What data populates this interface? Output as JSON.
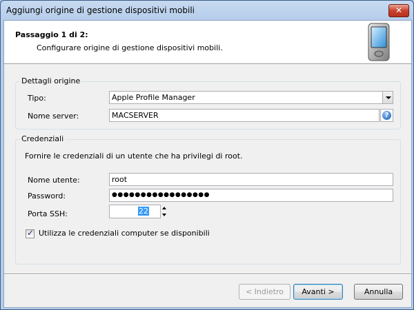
{
  "window": {
    "title": "Aggiungi origine di gestione dispositivi mobili",
    "close_symbol": "✕"
  },
  "header": {
    "step_title": "Passaggio 1 di 2:",
    "step_description": "Configurare origine di gestione dispositivi mobili.",
    "icon": "pda-device-icon"
  },
  "source_details": {
    "legend": "Dettagli origine",
    "type_label": "Tipo:",
    "type_value": "Apple Profile Manager",
    "server_label": "Nome server:",
    "server_value": "MACSERVER",
    "help_symbol": "?"
  },
  "credentials": {
    "legend": "Credenziali",
    "description": "Fornire le credenziali di un utente che ha privilegi di root.",
    "username_label": "Nome utente:",
    "username_value": "root",
    "password_label": "Password:",
    "password_value": "●●●●●●●●●●●●●●●●●",
    "ssh_port_label": "Porta SSH:",
    "ssh_port_value": "22",
    "use_computer_credentials_label": "Utilizza le credenziali computer se disponibili",
    "use_computer_credentials_checked": true
  },
  "buttons": {
    "back": "< Indietro",
    "next": "Avanti >",
    "cancel": "Annulla"
  }
}
